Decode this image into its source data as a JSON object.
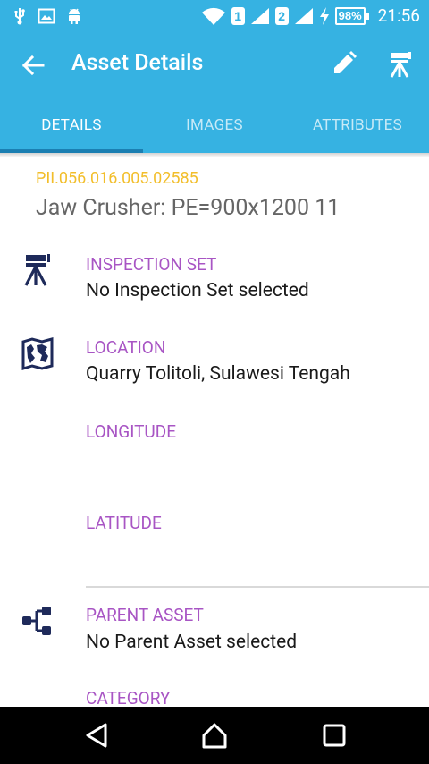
{
  "status_bar": {
    "sim1": "1",
    "sim2": "2",
    "battery": "98%",
    "time": "21:56"
  },
  "app_bar": {
    "title": "Asset Details"
  },
  "tabs": [
    {
      "label": "DETAILS",
      "active": true
    },
    {
      "label": "IMAGES",
      "active": false
    },
    {
      "label": "ATTRIBUTES",
      "active": false
    }
  ],
  "asset": {
    "code": "PII.056.016.005.02585",
    "name": "Jaw Crusher: PE=900x1200 11"
  },
  "fields": {
    "inspection_set": {
      "label": "INSPECTION SET",
      "value": "No Inspection Set selected"
    },
    "location": {
      "label": "LOCATION",
      "value": "Quarry Tolitoli, Sulawesi Tengah"
    },
    "longitude": {
      "label": "LONGITUDE",
      "value": ""
    },
    "latitude": {
      "label": "LATITUDE",
      "value": ""
    },
    "parent_asset": {
      "label": "PARENT ASSET",
      "value": "No Parent Asset selected"
    },
    "category": {
      "label": "CATEGORY"
    }
  },
  "colors": {
    "primary": "#36b2e2",
    "tab_indicator": "#1b7fb2",
    "asset_code": "#f2be2b",
    "field_label": "#a855c4",
    "icon": "#1e2a5a"
  },
  "icons": [
    "usb-icon",
    "image-icon",
    "android-icon",
    "wifi-icon",
    "signal-icon",
    "charging-icon",
    "back-arrow-icon",
    "pencil-icon",
    "survey-tripod-icon",
    "map-icon",
    "hierarchy-icon",
    "nav-back-icon",
    "nav-home-icon",
    "nav-recents-icon"
  ]
}
